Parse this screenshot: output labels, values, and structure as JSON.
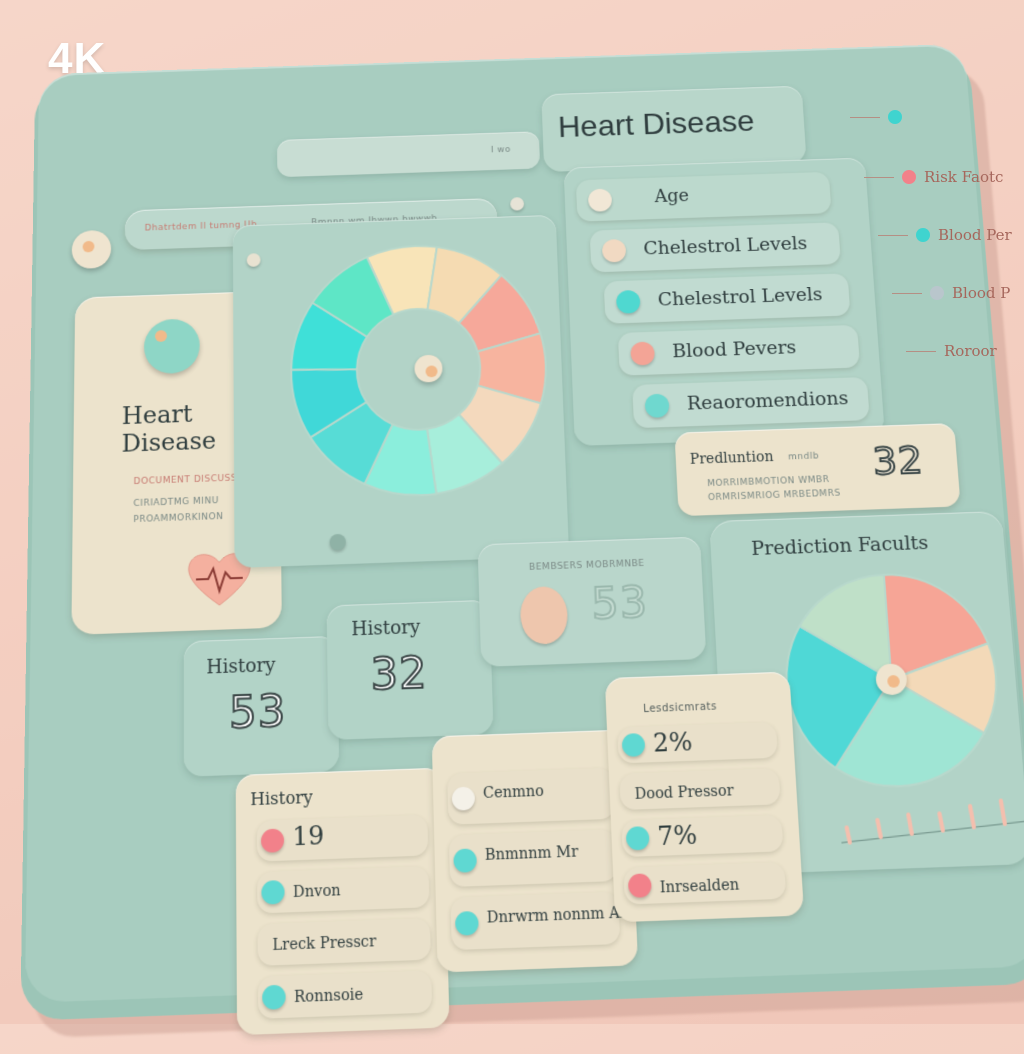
{
  "brand": "4K",
  "header": {
    "title": "Heart Disease",
    "top_bar_text": "Dhatrtdem Il tumng Ub",
    "top_bar_right": "Bmnnn wm Ihwwn bwwwb",
    "top_bar_tag": "I wo"
  },
  "left_card": {
    "title_line1": "Heart",
    "title_line2": "Disease",
    "fine_lines": [
      "DOCUMENT DISCUSS",
      "CIRIADTMG MINU",
      "PROAMMORKINON"
    ]
  },
  "risk_list": {
    "items": [
      {
        "label": "Age",
        "color": "#f1e7d6"
      },
      {
        "label": "Chelestrol Levels",
        "color": "#f1d9c2"
      },
      {
        "label": "Chelestrol Levels",
        "color": "#4fd8d0"
      },
      {
        "label": "Blood Pevers",
        "color": "#f3a496"
      },
      {
        "label": "Reaoromendions",
        "color": "#6fd8cf"
      }
    ]
  },
  "prediction_box": {
    "label": "Predluntion",
    "label_suffix": "mndlb",
    "value": "32",
    "fine_lines": [
      "MORRIMBMOTION WMBR",
      "ORMRISMRIOG MRBEDMRS"
    ]
  },
  "prediction_results": {
    "title": "Prediction Facults"
  },
  "history_a": {
    "label": "History",
    "value": "53"
  },
  "history_b": {
    "label": "History",
    "value": "32"
  },
  "history_c": {
    "value": "53",
    "fine": "BEMBSERS MOBRMNBE"
  },
  "list_a": {
    "title": "History",
    "items": [
      {
        "text": "19",
        "color": "#f2818a"
      },
      {
        "text": "Dnvon",
        "color": "#5fd8d2"
      },
      {
        "text": "Lreck Presscr",
        "color": ""
      },
      {
        "text": "Ronnsoie",
        "color": "#5fd8d2"
      }
    ]
  },
  "list_b": {
    "items": [
      {
        "text": "Cenmno",
        "color": "#f4f1e8"
      },
      {
        "text": "Bnmnnm Mr",
        "color": "#5fd8d2"
      },
      {
        "text": "Dnrwrm nonnm Ab",
        "color": "#5fd8d2"
      }
    ]
  },
  "list_c": {
    "title": "Lesdsicmrats",
    "items": [
      {
        "text": "2%",
        "color": "#5fd8d2"
      },
      {
        "text": "Dood Pressor",
        "color": ""
      },
      {
        "text": "7%",
        "color": "#5fd8d2"
      },
      {
        "text": "Inrsealden",
        "color": "#f2818a"
      }
    ]
  },
  "side_legend": [
    {
      "text": "",
      "color": "#3fd4cf"
    },
    {
      "text": "Risk Faotc",
      "color": "#f2818a"
    },
    {
      "text": "Blood Per",
      "color": "#3fd4cf"
    },
    {
      "text": "Blood P",
      "color": "#b9c6cc"
    },
    {
      "text": "Roroor",
      "color": ""
    }
  ],
  "donut_chart": {
    "segments": [
      {
        "color": "#f8e4b8",
        "value": 1
      },
      {
        "color": "#f5dbb2",
        "value": 1
      },
      {
        "color": "#f6a89a",
        "value": 1
      },
      {
        "color": "#f7b49f",
        "value": 1
      },
      {
        "color": "#f4d9bd",
        "value": 1
      },
      {
        "color": "#a7eedb",
        "value": 1
      },
      {
        "color": "#8beedc",
        "value": 1
      },
      {
        "color": "#57dcd6",
        "value": 1
      },
      {
        "color": "#40d8d8",
        "value": 1
      },
      {
        "color": "#3fe0d8",
        "value": 1
      },
      {
        "color": "#5ee6c6",
        "value": 1
      }
    ]
  },
  "pie_chart": {
    "segments": [
      {
        "color": "#f6a596",
        "value": 2
      },
      {
        "color": "#f3d9b8",
        "value": 1.4
      },
      {
        "color": "#9fe5d4",
        "value": 2.6
      },
      {
        "color": "#4fd8d6",
        "value": 2.4
      },
      {
        "color": "#bfe0c8",
        "value": 1.6
      }
    ]
  }
}
